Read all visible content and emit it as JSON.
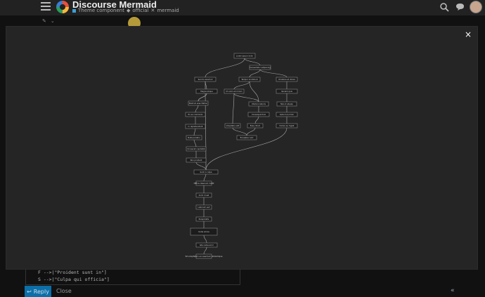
{
  "header": {
    "site_title": "Discourse Mermaid",
    "category": "Theme component",
    "tag_official": "official",
    "tag_mermaid": "mermaid"
  },
  "composer": {
    "reply_label": "Reply",
    "close_label": "Close",
    "editor_lines": [
      "F -->|\"Proident sunt in\"]",
      "S -->|\"Culpa qui officia\"]"
    ]
  },
  "lightbox": {
    "close_symbol": "×"
  },
  "diagram": {
    "nodes": [
      {
        "id": "A",
        "label": "Lorem ipsum dolor"
      },
      {
        "id": "B",
        "label": "Consectetur adipiscing"
      },
      {
        "id": "C",
        "label": "Sed do eiusmod"
      },
      {
        "id": "D",
        "label": "Tempor incididunt"
      },
      {
        "id": "E",
        "label": "Ut labore et dolore"
      },
      {
        "id": "F",
        "label": "Magna aliqua"
      },
      {
        "id": "G",
        "label": "Ut enim ad minim"
      },
      {
        "id": "H",
        "label": "Veniam quis"
      },
      {
        "id": "I",
        "label": "Nostrud exercitation"
      },
      {
        "id": "J",
        "label": "Ullamco laboris"
      },
      {
        "id": "K",
        "label": "Nisi ut aliquip"
      },
      {
        "id": "L",
        "label": "Ex ea commodo"
      },
      {
        "id": "M",
        "label": "Consequat duis"
      },
      {
        "id": "N",
        "label": "Aute irure dolor"
      },
      {
        "id": "O",
        "label": "In reprehenderit"
      },
      {
        "id": "P",
        "label": "Voluptate velit"
      },
      {
        "id": "Q",
        "label": "Esse cillum"
      },
      {
        "id": "R",
        "label": "Dolore eu fugiat"
      },
      {
        "id": "S",
        "label": "Nulla pariatur"
      },
      {
        "id": "T",
        "label": "Excepteur sint"
      },
      {
        "id": "U",
        "label": "Occaecat cupidatat"
      },
      {
        "id": "V",
        "label": "Non proident"
      },
      {
        "id": "W",
        "label": "Sunt in culpa"
      },
      {
        "id": "X",
        "label": "Officia deserunt mollit"
      },
      {
        "id": "Y",
        "label": "Anim id est"
      },
      {
        "id": "Z",
        "label": "Laborum sed"
      },
      {
        "id": "AA",
        "label": "Perspiciatis"
      },
      {
        "id": "AB",
        "label": "Unde omnis"
      },
      {
        "id": "AC",
        "label": "Iste natus error"
      },
      {
        "id": "AD",
        "label": "Sit voluptatem accusantium doloremque"
      },
      {
        "id": "AE",
        "label": "Laudantium totam rem"
      },
      {
        "id": "AF",
        "label": "Aperiam eaque ipsa"
      },
      {
        "id": "AG",
        "label": "Quae ab illo"
      }
    ]
  }
}
